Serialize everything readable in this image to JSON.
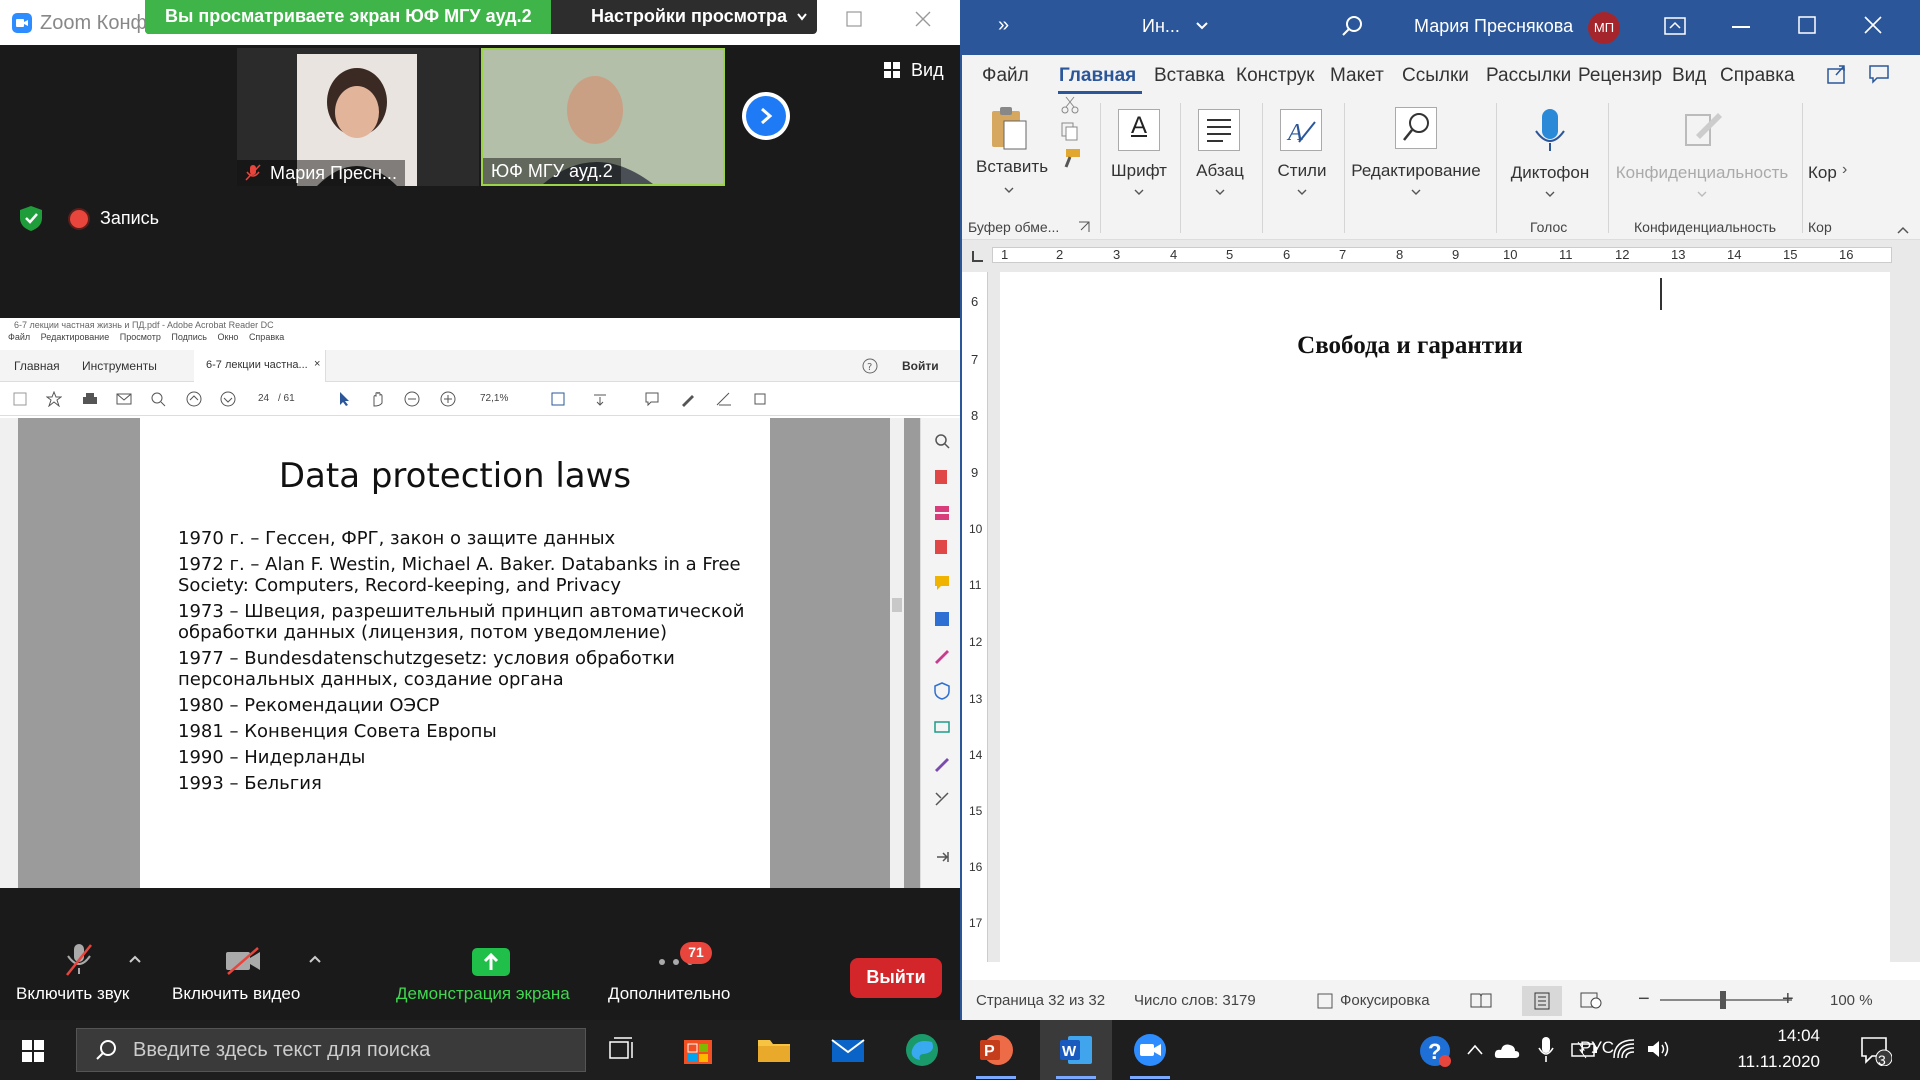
{
  "zoom": {
    "title": "Zoom Конфе",
    "share_banner": {
      "viewing": "Вы просматриваете экран ЮФ МГУ ауд.2",
      "view_settings": "Настройки просмотра"
    },
    "participants": [
      {
        "name": "Мария Пресн..."
      },
      {
        "name": "ЮФ МГУ ауд.2"
      }
    ],
    "view_label": "Вид",
    "recording_label": "Запись",
    "toolbar": {
      "unmute": "Включить звук",
      "start_video": "Включить видео",
      "share_screen": "Демонстрация экрана",
      "more": "Дополнительно",
      "more_badge": "71",
      "exit": "Выйти"
    }
  },
  "acrobat": {
    "title": "6-7 лекции частная жизнь и ПД.pdf - Adobe Acrobat Reader DC",
    "menu": [
      "Файл",
      "Редактирование",
      "Просмотр",
      "Подпись",
      "Окно",
      "Справка"
    ],
    "tabs": {
      "home": "Главная",
      "tools": "Инструменты",
      "doc": "6-7 лекции частна..."
    },
    "signin": "Войти",
    "page_current": "24",
    "page_total": "/ 61",
    "zoom_level": "72,1%",
    "slide": {
      "title": "Data protection laws",
      "lines": [
        "1970 г. – Гессен, ФРГ, закон о защите данных",
        "1972 г. – Alan F. Westin, Michael A. Baker. Databanks in a Free Society: Computers, Record-keeping, and Privacy",
        "1973 – Швеция, разрешительный принцип автоматической обработки данных (лицензия, потом уведомление)",
        "1977 – Bundesdatenschutzgesetz: условия обработки персональных данных, создание органа",
        "1980 – Рекомендации ОЭСР",
        "1981 – Конвенция Совета Европы",
        "1990 – Нидерланды",
        "1993 – Бельгия"
      ]
    }
  },
  "word": {
    "doc_title": "Ин...",
    "user": "Мария Преснякова",
    "user_initials": "МП",
    "tabs": [
      "Файл",
      "Главная",
      "Вставка",
      "Конструк",
      "Макет",
      "Ссылки",
      "Рассылки",
      "Рецензир",
      "Вид",
      "Справка"
    ],
    "ribbon": {
      "paste": "Вставить",
      "clipboard_group": "Буфер обме...",
      "font": "Шрифт",
      "paragraph": "Абзац",
      "styles": "Стили",
      "editing": "Редактирование",
      "dictate": "Диктофон",
      "voice_group": "Голос",
      "sensitivity": "Конфиденциальность",
      "sensitivity_group": "Конфиденциальность",
      "cor": "Кор",
      "cor_group": "Кор"
    },
    "ruler_numbers": [
      "1",
      "2",
      "3",
      "4",
      "5",
      "6",
      "7",
      "8",
      "9",
      "10",
      "11",
      "12",
      "13",
      "14",
      "15",
      "16"
    ],
    "vruler_numbers": [
      "6",
      "7",
      "8",
      "9",
      "10",
      "11",
      "12",
      "13",
      "14",
      "15",
      "16",
      "17"
    ],
    "heading": "Свобода и гарантии",
    "status": {
      "page": "Страница 32 из 32",
      "words": "Число слов: 3179",
      "focus": "Фокусировка",
      "zoom": "100 %"
    }
  },
  "taskbar": {
    "search_placeholder": "Введите здесь текст для поиска",
    "lang": "РУС",
    "time": "14:04",
    "date": "11.11.2020",
    "notifications": "3"
  }
}
